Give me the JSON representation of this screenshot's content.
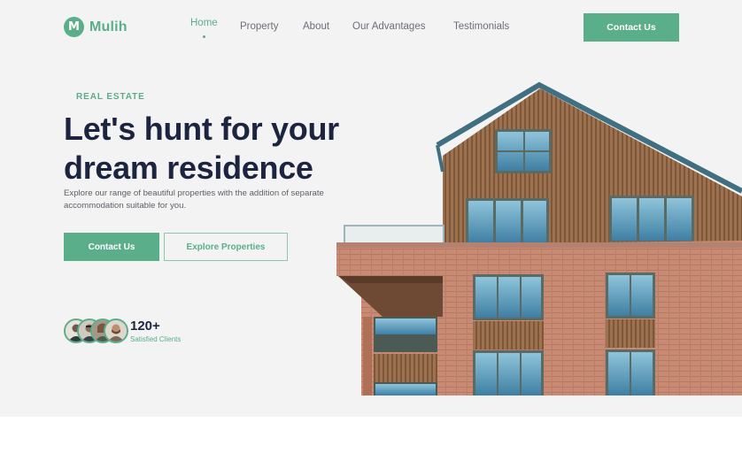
{
  "brand": {
    "logo_letter": "M",
    "name": "Mulih",
    "accent": "#5aae8a",
    "heading_color": "#1d2440"
  },
  "nav": {
    "items": [
      {
        "label": "Home",
        "active": true
      },
      {
        "label": "Property",
        "active": false
      },
      {
        "label": "About",
        "active": false
      },
      {
        "label": "Our Advantages",
        "active": false
      },
      {
        "label": "Testimonials",
        "active": false
      }
    ],
    "cta_label": "Contact Us"
  },
  "hero": {
    "eyebrow": "REAL ESTATE",
    "headline_line1": "Let's hunt for your",
    "headline_line2": "dream residence",
    "subcopy": "Explore our range of beautiful properties with the addition of separate accommodation suitable for you.",
    "primary_button": "Contact Us",
    "secondary_button": "Explore Properties",
    "clients_count": "120+",
    "clients_label": "Satisfied Clients",
    "avatar_count": 4
  }
}
